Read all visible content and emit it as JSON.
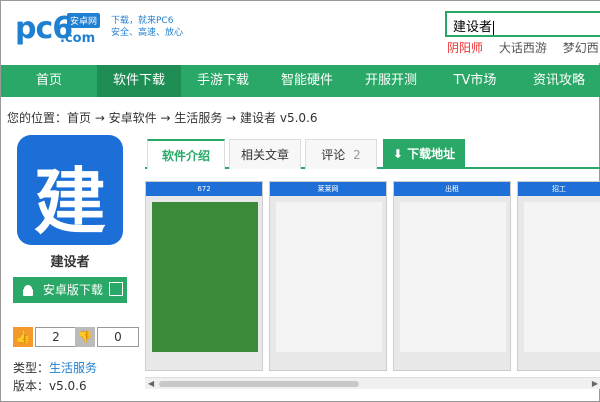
{
  "header": {
    "logo_text": "pc6",
    "logo_suffix": ".com",
    "logo_badge": "安卓网",
    "slogan_line1": "下载，就来PC6",
    "slogan_line2": "安全、高速、放心",
    "search_value": "建设者",
    "hot_words": [
      "阴阳师",
      "大话西游",
      "梦幻西"
    ]
  },
  "nav": {
    "items": [
      "首页",
      "软件下载",
      "手游下载",
      "智能硬件",
      "开服开测",
      "TV市场",
      "资讯攻略"
    ],
    "active_index": 1
  },
  "breadcrumb": "您的位置：首页 → 安卓软件 → 生活服务 → 建设者 v5.0.6",
  "app": {
    "icon_glyph": "建",
    "name": "建设者",
    "download_label": "安卓版下载",
    "like_count": "2",
    "dislike_count": "0",
    "category_label": "类型：",
    "category_value": "生活服务",
    "version_label": "版本：v5.0.6"
  },
  "tabs": {
    "intro": "软件介绍",
    "related": "相关文章",
    "comments": "评论",
    "comments_count": "2",
    "download": "下载地址"
  },
  "screenshots": {
    "titles": [
      "672",
      "莱莱网",
      "出租",
      "招工"
    ]
  },
  "colors": {
    "brand_green": "#2aa867",
    "brand_blue": "#1f7fd1",
    "hot_red": "#e33333",
    "like_orange": "#f39a2b"
  }
}
